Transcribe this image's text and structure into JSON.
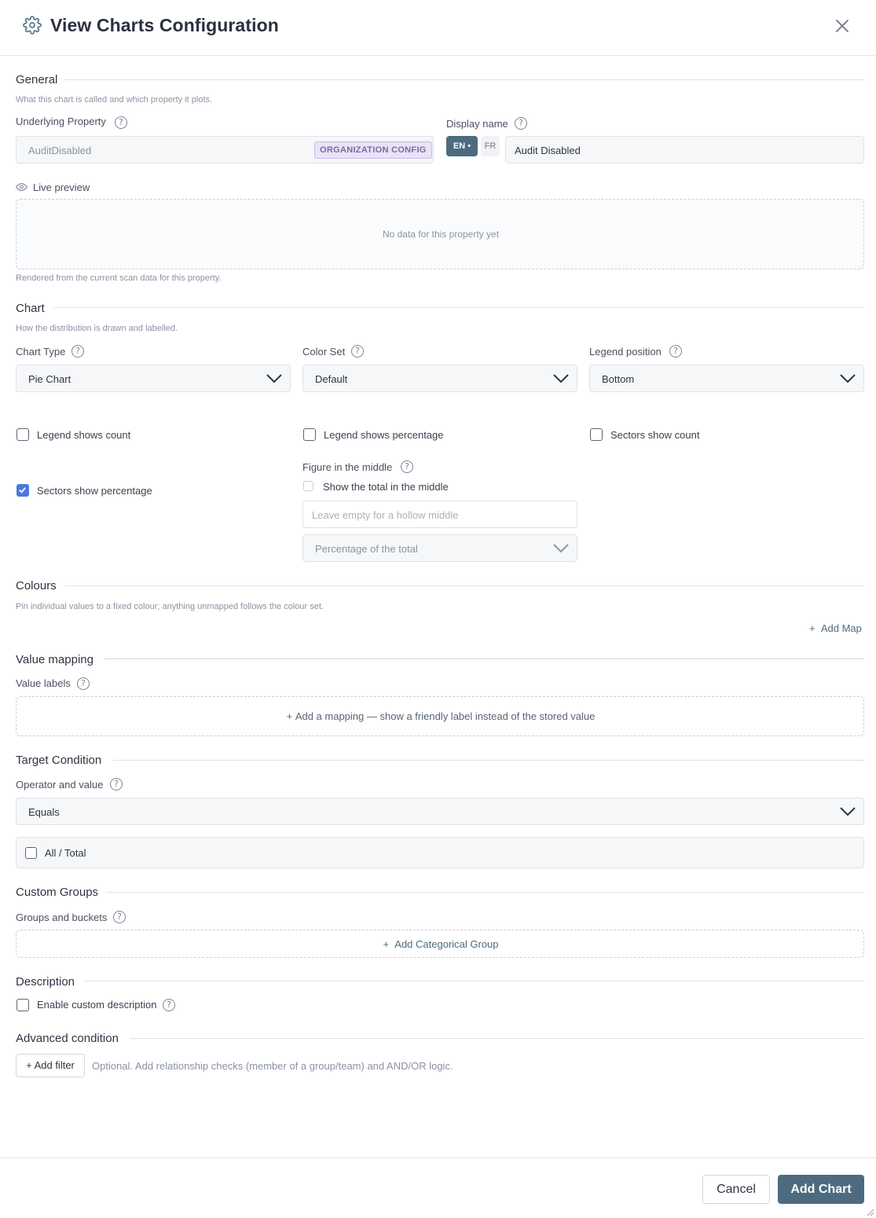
{
  "header": {
    "title": "View Charts Configuration",
    "icon": "gear-icon",
    "close_icon": "close-icon"
  },
  "general": {
    "title": "General",
    "subtitle": "What this chart is called and which property it plots.",
    "underlying_property": {
      "label": "Underlying Property",
      "value": "AuditDisabled",
      "badge": "ORGANIZATION CONFIG"
    },
    "display_name": {
      "label": "Display name",
      "lang_active": "EN",
      "lang_other": "FR",
      "value": "Audit Disabled"
    },
    "live_preview": {
      "label": "Live preview",
      "empty_text": "No data for this property yet",
      "footnote": "Rendered from the current scan data for this property."
    }
  },
  "chart": {
    "title": "Chart",
    "subtitle": "How the distribution is drawn and labelled.",
    "chart_type": {
      "label": "Chart Type",
      "value": "Pie Chart"
    },
    "color_set": {
      "label": "Color Set",
      "value": "Default"
    },
    "legend_position": {
      "label": "Legend position",
      "value": "Bottom"
    },
    "legend_shows_count": {
      "label": "Legend shows count",
      "checked": false
    },
    "legend_shows_percentage": {
      "label": "Legend shows percentage",
      "checked": false
    },
    "sectors_show_count": {
      "label": "Sectors show count",
      "checked": false
    },
    "sectors_show_percentage": {
      "label": "Sectors show percentage",
      "checked": true
    },
    "figure_middle": {
      "label": "Figure in the middle",
      "show_total_label": "Show the total in the middle",
      "input_placeholder": "Leave empty for a hollow middle",
      "select_value": "Percentage of the total"
    }
  },
  "colours": {
    "title": "Colours",
    "subtitle": "Pin individual values to a fixed colour; anything unmapped follows the colour set.",
    "add_map": "Add Map"
  },
  "value_mapping": {
    "title": "Value mapping",
    "label": "Value labels",
    "add_mapping": "Add a mapping — show a friendly label instead of the stored value"
  },
  "target_condition": {
    "title": "Target Condition",
    "label": "Operator and value",
    "operator": "Equals",
    "all_total": "All / Total"
  },
  "custom_groups": {
    "title": "Custom Groups",
    "label": "Groups and buckets",
    "add_group": "Add Categorical Group"
  },
  "description": {
    "title": "Description",
    "enable_label": "Enable custom description"
  },
  "advanced": {
    "title": "Advanced condition",
    "add_filter": "+ Add filter",
    "hint": "Optional. Add relationship checks (member of a group/team) and AND/OR logic."
  },
  "footer": {
    "cancel": "Cancel",
    "add_chart": "Add Chart"
  },
  "colors": {
    "accent": "#4c6b7f",
    "checkbox_checked": "#4a78e0",
    "badge_bg": "#e8e3f5"
  }
}
